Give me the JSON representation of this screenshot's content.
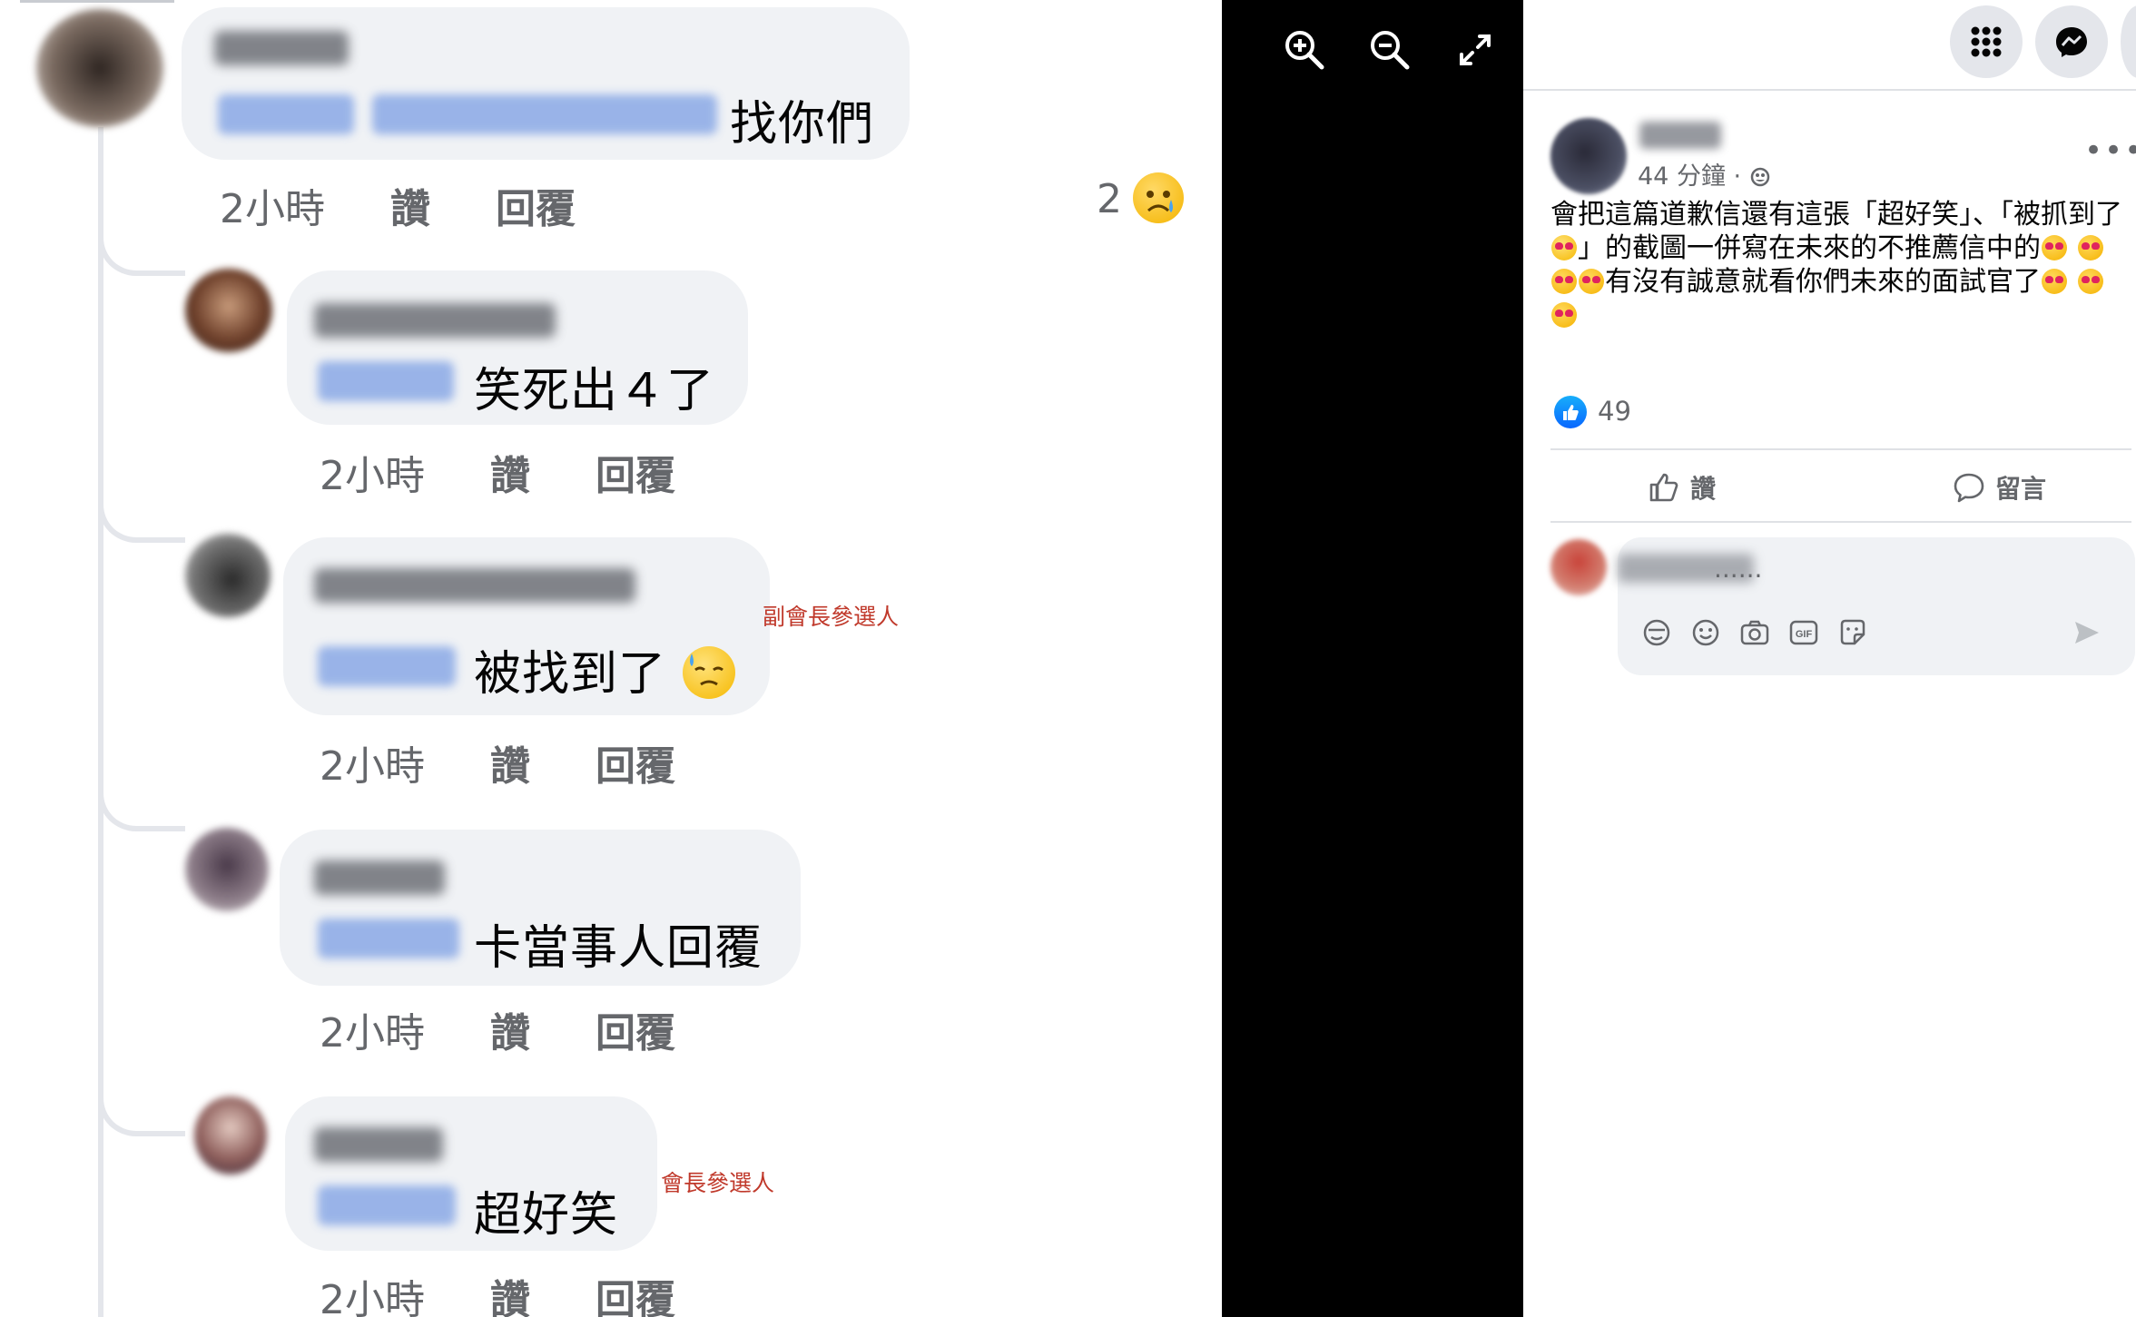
{
  "photo": {
    "comments": [
      {
        "text": "找你們",
        "time": "2小時",
        "like": "讚",
        "reply": "回覆",
        "reaction_count": "2"
      },
      {
        "text": "笑死出４了",
        "time": "2小時",
        "like": "讚",
        "reply": "回覆"
      },
      {
        "text": "被找到了",
        "time": "2小時",
        "like": "讚",
        "reply": "回覆",
        "note": "副會長參選人"
      },
      {
        "text": "卡當事人回覆",
        "time": "2小時",
        "like": "讚",
        "reply": "回覆"
      },
      {
        "text": "超好笑",
        "time": "2小時",
        "like": "讚",
        "reply": "回覆",
        "note": "會長參選人"
      }
    ]
  },
  "viewer": {
    "icons": [
      "zoom-in-icon",
      "zoom-out-icon",
      "fullscreen-icon"
    ]
  },
  "panel": {
    "top_icons": [
      "menu-grid-icon",
      "messenger-icon"
    ],
    "post": {
      "time": "44 分鐘 ·",
      "text_1": "會把這篇道歉信還有這張「超好笑」、「被抓到了",
      "text_2": "」的截圖一併寫在未來的不推薦信中的",
      "text_3": "有沒有誠意就看你們未來的面試官了",
      "likes": "49",
      "like_label": "讚",
      "comment_label": "留言"
    },
    "comment_box": {
      "placeholder": "......",
      "tools": [
        "avatar-sticker-icon",
        "emoji-icon",
        "camera-icon",
        "gif-icon",
        "sticker-icon"
      ]
    },
    "colors": {
      "accent": "#0866ff",
      "note": "#c0392b"
    }
  }
}
